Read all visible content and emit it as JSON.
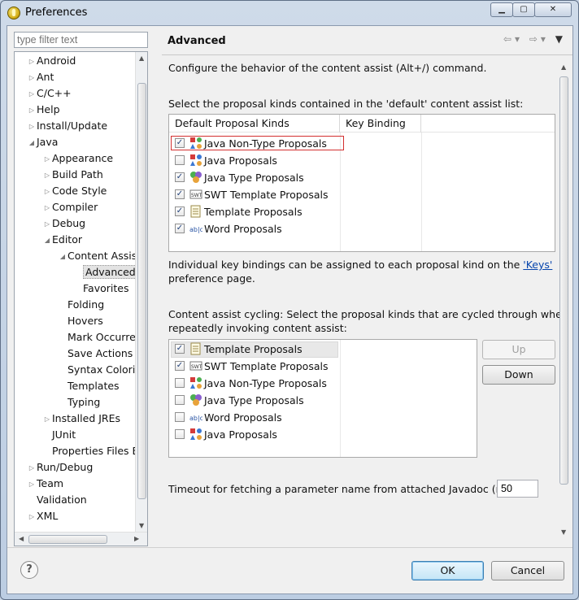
{
  "window": {
    "title": "Preferences"
  },
  "filter": {
    "placeholder": "type filter text"
  },
  "tree": [
    {
      "label": "Android",
      "depth": 0,
      "toggle": "collapsed"
    },
    {
      "label": "Ant",
      "depth": 0,
      "toggle": "collapsed"
    },
    {
      "label": "C/C++",
      "depth": 0,
      "toggle": "collapsed"
    },
    {
      "label": "Help",
      "depth": 0,
      "toggle": "collapsed"
    },
    {
      "label": "Install/Update",
      "depth": 0,
      "toggle": "collapsed"
    },
    {
      "label": "Java",
      "depth": 0,
      "toggle": "expanded"
    },
    {
      "label": "Appearance",
      "depth": 1,
      "toggle": "collapsed"
    },
    {
      "label": "Build Path",
      "depth": 1,
      "toggle": "collapsed"
    },
    {
      "label": "Code Style",
      "depth": 1,
      "toggle": "collapsed"
    },
    {
      "label": "Compiler",
      "depth": 1,
      "toggle": "collapsed"
    },
    {
      "label": "Debug",
      "depth": 1,
      "toggle": "collapsed"
    },
    {
      "label": "Editor",
      "depth": 1,
      "toggle": "expanded"
    },
    {
      "label": "Content Assist",
      "depth": 2,
      "toggle": "expanded"
    },
    {
      "label": "Advanced",
      "depth": 3,
      "toggle": "none",
      "selected": true
    },
    {
      "label": "Favorites",
      "depth": 3,
      "toggle": "none"
    },
    {
      "label": "Folding",
      "depth": 2,
      "toggle": "none"
    },
    {
      "label": "Hovers",
      "depth": 2,
      "toggle": "none"
    },
    {
      "label": "Mark Occurren",
      "depth": 2,
      "toggle": "none"
    },
    {
      "label": "Save Actions",
      "depth": 2,
      "toggle": "none"
    },
    {
      "label": "Syntax Coloring",
      "depth": 2,
      "toggle": "none"
    },
    {
      "label": "Templates",
      "depth": 2,
      "toggle": "none"
    },
    {
      "label": "Typing",
      "depth": 2,
      "toggle": "none"
    },
    {
      "label": "Installed JREs",
      "depth": 1,
      "toggle": "collapsed"
    },
    {
      "label": "JUnit",
      "depth": 1,
      "toggle": "none"
    },
    {
      "label": "Properties Files Ed",
      "depth": 1,
      "toggle": "none"
    },
    {
      "label": "Run/Debug",
      "depth": 0,
      "toggle": "collapsed"
    },
    {
      "label": "Team",
      "depth": 0,
      "toggle": "collapsed"
    },
    {
      "label": "Validation",
      "depth": 0,
      "toggle": "none"
    },
    {
      "label": "XML",
      "depth": 0,
      "toggle": "collapsed"
    }
  ],
  "page": {
    "title": "Advanced",
    "description": "Configure the behavior of the content assist (Alt+/) command.",
    "default_list_label": "Select the proposal kinds contained in the 'default' content assist list:",
    "columns": {
      "kinds": "Default Proposal Kinds",
      "binding": "Key Binding"
    },
    "default_proposals": [
      {
        "label": "Java Non-Type Proposals",
        "checked": true,
        "icon": "java-non-type-icon",
        "highlighted": true
      },
      {
        "label": "Java Proposals",
        "checked": false,
        "icon": "java-proposals-icon"
      },
      {
        "label": "Java Type Proposals",
        "checked": true,
        "icon": "java-type-icon"
      },
      {
        "label": "SWT Template Proposals",
        "checked": true,
        "icon": "swt-template-icon"
      },
      {
        "label": "Template Proposals",
        "checked": true,
        "icon": "template-icon"
      },
      {
        "label": "Word Proposals",
        "checked": true,
        "icon": "word-icon"
      }
    ],
    "keybinding_text": "Individual key bindings can be assigned to each proposal kind on the ",
    "keys_link": "'Keys'",
    "keybinding_text2": "preference page.",
    "cycling_label_1": "Content assist cycling: Select the proposal kinds that are cycled through when",
    "cycling_label_2": "repeatedly invoking content assist:",
    "cycling_proposals": [
      {
        "label": "Template Proposals",
        "checked": true,
        "icon": "template-icon",
        "selected": true
      },
      {
        "label": "SWT Template Proposals",
        "checked": true,
        "icon": "swt-template-icon"
      },
      {
        "label": "Java Non-Type Proposals",
        "checked": false,
        "icon": "java-non-type-icon"
      },
      {
        "label": "Java Type Proposals",
        "checked": false,
        "icon": "java-type-icon"
      },
      {
        "label": "Word Proposals",
        "checked": false,
        "icon": "word-icon"
      },
      {
        "label": "Java Proposals",
        "checked": false,
        "icon": "java-proposals-icon"
      }
    ],
    "up_label": "Up",
    "down_label": "Down",
    "timeout_label": "Timeout for fetching a parameter name from attached Javadoc (ms):",
    "timeout_value": "50"
  },
  "buttons": {
    "ok": "OK",
    "cancel": "Cancel",
    "help": "?"
  }
}
